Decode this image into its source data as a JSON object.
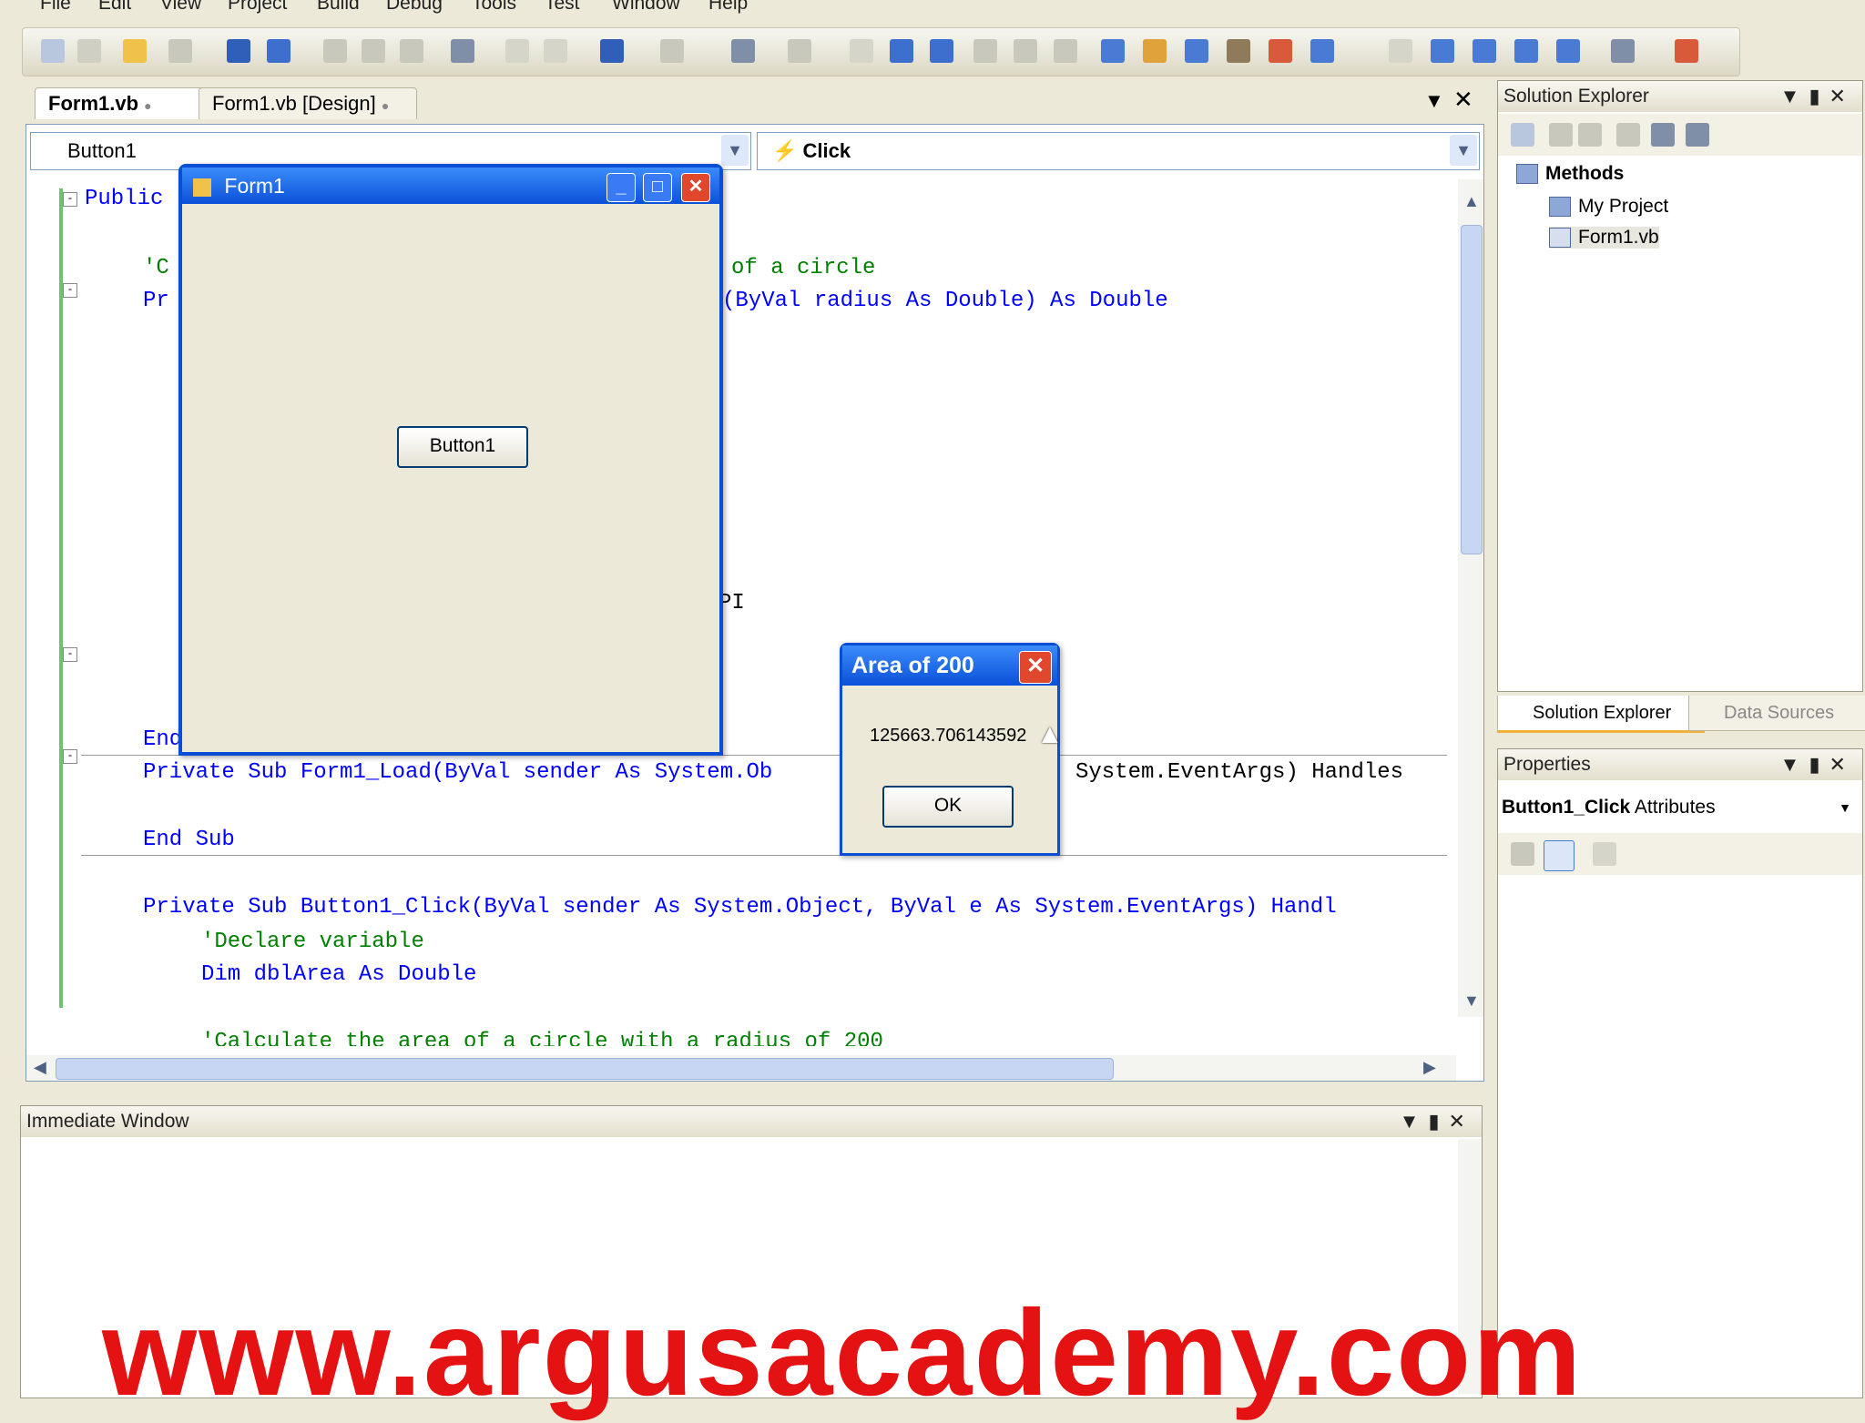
{
  "menu": [
    "File",
    "Edit",
    "View",
    "Project",
    "Build",
    "Debug",
    "Tools",
    "Test",
    "Window",
    "Help"
  ],
  "editor": {
    "tabs": [
      "Form1.vb",
      "Form1.vb [Design]"
    ],
    "object_combo": "Button1",
    "event_combo": "Click",
    "code_lines": [
      {
        "text": "Public",
        "kind": "kw"
      },
      {
        "text": "'C",
        "kind": "cm"
      },
      {
        "text": "of a circle",
        "kind": "cm"
      },
      {
        "text": "Pr",
        "kind": "kw"
      },
      {
        "text": "(ByVal radius As Double) As Double",
        "kind": "mixed"
      },
      {
        "text": "PI",
        "kind": "plain"
      },
      {
        "text": "End",
        "kind": "kw"
      },
      {
        "text": "Private Sub Form1_Load(ByVal sender As System.Ob",
        "kind": "mixed"
      },
      {
        "text": "System.EventArgs) Handles",
        "kind": "mixed"
      },
      {
        "text": "End Sub",
        "kind": "kw"
      },
      {
        "text": "Private Sub Button1_Click(ByVal sender As System.Object, ByVal e As System.EventArgs) Handl",
        "kind": "mixed"
      },
      {
        "text": "'Declare variable",
        "kind": "cm"
      },
      {
        "text": "Dim dblArea As Double",
        "kind": "mixed"
      },
      {
        "text": "'Calculate the area of a circle with a radius of 200",
        "kind": "cm"
      }
    ]
  },
  "form1": {
    "title": "Form1",
    "button_label": "Button1"
  },
  "msgbox": {
    "title": "Area of 200",
    "message": "125663.706143592",
    "ok_label": "OK"
  },
  "solution_explorer": {
    "title": "Solution Explorer",
    "items": [
      "Methods",
      "My Project",
      "Form1.vb"
    ],
    "tabs": [
      "Solution Explorer",
      "Data Sources"
    ]
  },
  "properties": {
    "title": "Properties",
    "object": "Button1_Click",
    "object_type": "Attributes"
  },
  "immediate": {
    "title": "Immediate Window"
  },
  "watermark": "www.argusacademy.com",
  "colors": {
    "title_blue": "#0a51d9",
    "keyword": "#0000ff",
    "comment": "#008000",
    "watermark": "#e41212"
  }
}
